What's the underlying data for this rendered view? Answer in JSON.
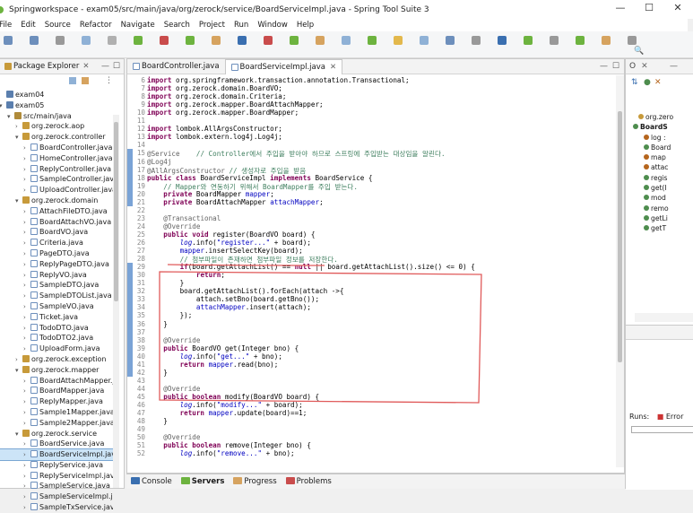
{
  "window": {
    "title": "Springworkspace - exam05/src/main/java/org/zerock/service/BoardServiceImpl.java - Spring Tool Suite 3",
    "minimize": "—",
    "maximize": "☐",
    "close": "✕"
  },
  "menu": [
    "File",
    "Edit",
    "Source",
    "Refactor",
    "Navigate",
    "Search",
    "Project",
    "Run",
    "Window",
    "Help"
  ],
  "explorer": {
    "tab_label": "Package Explorer",
    "rows": [
      {
        "label": "exam04",
        "type": "proj",
        "indent": 0,
        "arrow": ""
      },
      {
        "label": "exam05",
        "type": "proj",
        "indent": 0,
        "arrow": "v"
      },
      {
        "label": "src/main/java",
        "type": "src",
        "indent": 1,
        "arrow": "v"
      },
      {
        "label": "org.zerock.aop",
        "type": "pkg",
        "indent": 2,
        "arrow": ">"
      },
      {
        "label": "org.zerock.controller",
        "type": "pkg",
        "indent": 2,
        "arrow": "v"
      },
      {
        "label": "BoardController.java",
        "type": "java",
        "indent": 3,
        "arrow": ">"
      },
      {
        "label": "HomeController.java",
        "type": "java",
        "indent": 3,
        "arrow": ">"
      },
      {
        "label": "ReplyController.java",
        "type": "java",
        "indent": 3,
        "arrow": ">"
      },
      {
        "label": "SampleController.java",
        "type": "java",
        "indent": 3,
        "arrow": ">"
      },
      {
        "label": "UploadController.java",
        "type": "java",
        "indent": 3,
        "arrow": ">"
      },
      {
        "label": "org.zerock.domain",
        "type": "pkg",
        "indent": 2,
        "arrow": "v"
      },
      {
        "label": "AttachFileDTO.java",
        "type": "java",
        "indent": 3,
        "arrow": ">"
      },
      {
        "label": "BoardAttachVO.java",
        "type": "java",
        "indent": 3,
        "arrow": ">"
      },
      {
        "label": "BoardVO.java",
        "type": "java",
        "indent": 3,
        "arrow": ">"
      },
      {
        "label": "Criteria.java",
        "type": "java",
        "indent": 3,
        "arrow": ">"
      },
      {
        "label": "PageDTO.java",
        "type": "java",
        "indent": 3,
        "arrow": ">"
      },
      {
        "label": "ReplyPageDTO.java",
        "type": "java",
        "indent": 3,
        "arrow": ">"
      },
      {
        "label": "ReplyVO.java",
        "type": "java",
        "indent": 3,
        "arrow": ">"
      },
      {
        "label": "SampleDTO.java",
        "type": "java",
        "indent": 3,
        "arrow": ">"
      },
      {
        "label": "SampleDTOList.java",
        "type": "java",
        "indent": 3,
        "arrow": ">"
      },
      {
        "label": "SampleVO.java",
        "type": "java",
        "indent": 3,
        "arrow": ">"
      },
      {
        "label": "Ticket.java",
        "type": "java",
        "indent": 3,
        "arrow": ">"
      },
      {
        "label": "TodoDTO.java",
        "type": "java",
        "indent": 3,
        "arrow": ">"
      },
      {
        "label": "TodoDTO2.java",
        "type": "java",
        "indent": 3,
        "arrow": ">"
      },
      {
        "label": "UploadForm.java",
        "type": "java",
        "indent": 3,
        "arrow": ">"
      },
      {
        "label": "org.zerock.exception",
        "type": "pkg",
        "indent": 2,
        "arrow": ">"
      },
      {
        "label": "org.zerock.mapper",
        "type": "pkg",
        "indent": 2,
        "arrow": "v"
      },
      {
        "label": "BoardAttachMapper.jav",
        "type": "java",
        "indent": 3,
        "arrow": ">"
      },
      {
        "label": "BoardMapper.java",
        "type": "java",
        "indent": 3,
        "arrow": ">"
      },
      {
        "label": "ReplyMapper.java",
        "type": "java",
        "indent": 3,
        "arrow": ">"
      },
      {
        "label": "Sample1Mapper.java",
        "type": "java",
        "indent": 3,
        "arrow": ">"
      },
      {
        "label": "Sample2Mapper.java",
        "type": "java",
        "indent": 3,
        "arrow": ">"
      },
      {
        "label": "org.zerock.service",
        "type": "pkg",
        "indent": 2,
        "arrow": "v"
      },
      {
        "label": "BoardService.java",
        "type": "java",
        "indent": 3,
        "arrow": ">"
      },
      {
        "label": "BoardServiceImpl.java",
        "type": "java",
        "indent": 3,
        "arrow": ">",
        "selected": true
      },
      {
        "label": "ReplyService.java",
        "type": "java",
        "indent": 3,
        "arrow": ">"
      },
      {
        "label": "ReplyServiceImpl.java",
        "type": "java",
        "indent": 3,
        "arrow": ">"
      },
      {
        "label": "SampleService.java",
        "type": "java",
        "indent": 3,
        "arrow": ">"
      },
      {
        "label": "SampleServiceImpl.java",
        "type": "java",
        "indent": 3,
        "arrow": ">"
      },
      {
        "label": "SampleTxService.java",
        "type": "java",
        "indent": 3,
        "arrow": ">"
      }
    ]
  },
  "editor": {
    "tabs": [
      {
        "label": "BoardController.java",
        "active": false
      },
      {
        "label": "BoardServiceImpl.java",
        "active": true
      }
    ],
    "lines": [
      {
        "n": "6",
        "html": "<span class=\"kw\">import</span> org.springframework.transaction.annotation.Transactional;"
      },
      {
        "n": "7",
        "html": "<span class=\"kw\">import</span> org.zerock.domain.BoardVO;"
      },
      {
        "n": "8",
        "html": "<span class=\"kw\">import</span> org.zerock.domain.Criteria;"
      },
      {
        "n": "9",
        "html": "<span class=\"kw\">import</span> org.zerock.mapper.BoardAttachMapper;"
      },
      {
        "n": "10",
        "html": "<span class=\"kw\">import</span> org.zerock.mapper.BoardMapper;"
      },
      {
        "n": "11",
        "html": ""
      },
      {
        "n": "12",
        "html": "<span class=\"kw\">import</span> lombok.AllArgsConstructor;"
      },
      {
        "n": "13",
        "html": "<span class=\"kw\">import</span> lombok.extern.log4j.Log4j;"
      },
      {
        "n": "14",
        "html": ""
      },
      {
        "n": "15",
        "html": "<span class=\"an\">@Service</span>    <span class=\"cm\">// Controller에서 주입을 받아야 하므로 스프링에 주입받는 대상임을 알린다.</span>"
      },
      {
        "n": "16",
        "html": "<span class=\"an\">@Log4j</span>"
      },
      {
        "n": "17",
        "html": "<span class=\"an\">@AllArgsConstructor</span> <span class=\"cm\">// 생성자로 주입을 받음</span>"
      },
      {
        "n": "18",
        "html": "<span class=\"kw\">public class</span> BoardServiceImpl <span class=\"kw\">implements</span> BoardService {"
      },
      {
        "n": "19",
        "html": "    <span class=\"cm\">// Mapper와 연동하기 위해서 BoardMapper를 주입 받는다.</span>"
      },
      {
        "n": "20",
        "html": "    <span class=\"kw\">private</span> BoardMapper <span class=\"fd\">mapper</span>;"
      },
      {
        "n": "21",
        "html": "    <span class=\"kw\">private</span> BoardAttachMapper <span class=\"fd\">attachMapper</span>;"
      },
      {
        "n": "22",
        "html": ""
      },
      {
        "n": "23",
        "html": "    <span class=\"an\">@Transactional</span>"
      },
      {
        "n": "24",
        "html": "    <span class=\"an\">@Override</span>"
      },
      {
        "n": "25",
        "html": "    <span class=\"kw\">public void</span> register(BoardVO board) {"
      },
      {
        "n": "26",
        "html": "        <span class=\"fd it\">log</span>.info(<span class=\"fd\">\"register...\"</span> + board);"
      },
      {
        "n": "27",
        "html": "        <span class=\"fd\">mapper</span>.insertSelectKey(board);"
      },
      {
        "n": "28",
        "html": "        <span class=\"cm\">// 첨부파일이 존재하면 첨부파일 정보를 저장한다.</span>"
      },
      {
        "n": "29",
        "html": "        <span class=\"kw\">if</span>(board.getAttachList() == <span class=\"kw\">null</span> || board.getAttachList().size() &lt;= 0) {"
      },
      {
        "n": "30",
        "html": "            <span class=\"kw\">return</span>;"
      },
      {
        "n": "31",
        "html": "        }"
      },
      {
        "n": "32",
        "html": "        board.getAttachList().forEach(attach -&gt;{"
      },
      {
        "n": "33",
        "html": "            attach.setBno(board.getBno());"
      },
      {
        "n": "34",
        "html": "            <span class=\"fd\">attachMapper</span>.insert(attach);"
      },
      {
        "n": "35",
        "html": "        });"
      },
      {
        "n": "36",
        "html": "    }"
      },
      {
        "n": "37",
        "html": ""
      },
      {
        "n": "38",
        "html": "    <span class=\"an\">@Override</span>"
      },
      {
        "n": "39",
        "html": "    <span class=\"kw\">public</span> BoardVO get(Integer bno) {"
      },
      {
        "n": "40",
        "html": "        <span class=\"fd it\">log</span>.info(<span class=\"fd\">\"get...\"</span> + bno);"
      },
      {
        "n": "41",
        "html": "        <span class=\"kw\">return</span> <span class=\"fd\">mapper</span>.read(bno);"
      },
      {
        "n": "42",
        "html": "    }"
      },
      {
        "n": "43",
        "html": ""
      },
      {
        "n": "44",
        "html": "    <span class=\"an\">@Override</span>"
      },
      {
        "n": "45",
        "html": "    <span class=\"kw\">public boolean</span> modify(BoardVO board) {"
      },
      {
        "n": "46",
        "html": "        <span class=\"fd it\">log</span>.info(<span class=\"fd\">\"modify...\"</span> + board);"
      },
      {
        "n": "47",
        "html": "        <span class=\"kw\">return</span> <span class=\"fd\">mapper</span>.update(board)==1;"
      },
      {
        "n": "48",
        "html": "    }"
      },
      {
        "n": "49",
        "html": ""
      },
      {
        "n": "50",
        "html": "    <span class=\"an\">@Override</span>"
      },
      {
        "n": "51",
        "html": "    <span class=\"kw\">public boolean</span> remove(Integer bno) {"
      },
      {
        "n": "52",
        "html": "        <span class=\"fd it\">log</span>.info(<span class=\"fd\">\"remove...\"</span> + bno);"
      }
    ]
  },
  "outline": {
    "rows": [
      {
        "label": "org.zero",
        "color": "#c79a3a"
      },
      {
        "label": "BoardS",
        "color": "#4e8d4e"
      },
      {
        "label": "log :",
        "color": "#b5651d"
      },
      {
        "label": "Board",
        "color": "#4e8d4e"
      },
      {
        "label": "map",
        "color": "#b5651d"
      },
      {
        "label": "attac",
        "color": "#b5651d"
      },
      {
        "label": "regis",
        "color": "#4e8d4e"
      },
      {
        "label": "get(I",
        "color": "#4e8d4e"
      },
      {
        "label": "mod",
        "color": "#4e8d4e"
      },
      {
        "label": "remo",
        "color": "#4e8d4e"
      },
      {
        "label": "getLi",
        "color": "#4e8d4e"
      },
      {
        "label": "getT",
        "color": "#4e8d4e"
      }
    ]
  },
  "junit": {
    "runs_label": "Runs:",
    "errors_label": "Error"
  },
  "bottom_tabs": [
    "Console",
    "Servers",
    "Progress",
    "Problems"
  ],
  "colors": {
    "accent": "#7aa3d6",
    "annotation_red": "#e05a5a"
  }
}
